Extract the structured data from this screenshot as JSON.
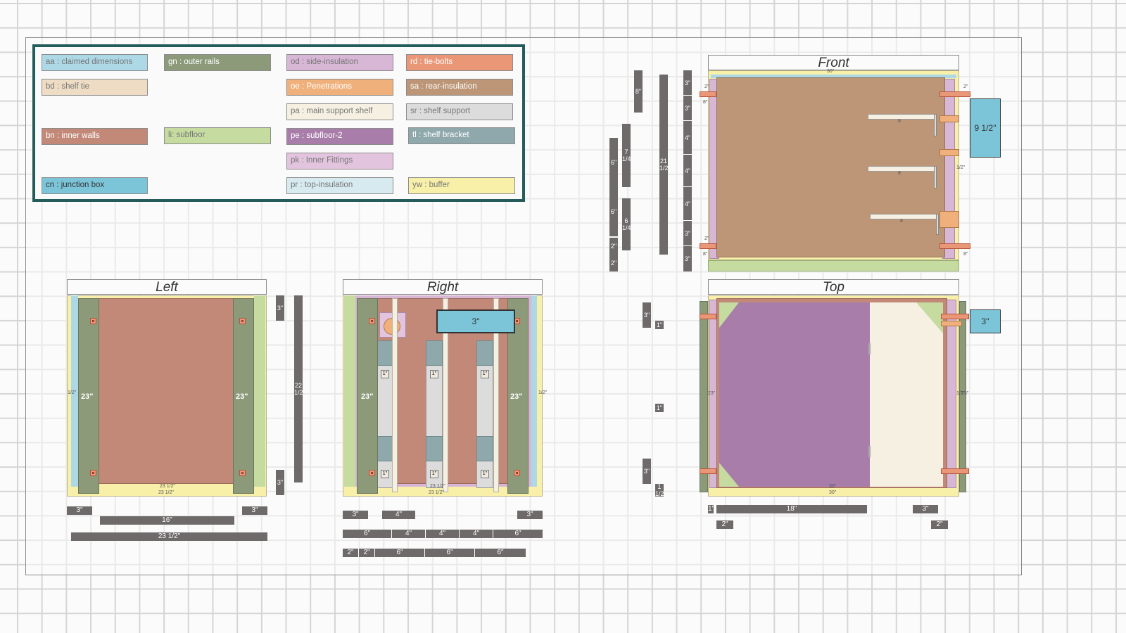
{
  "legend": [
    {
      "code": "aa",
      "label": "aa : claimed dimensions",
      "color": "#add8e6",
      "text": "#777777"
    },
    {
      "code": "gn",
      "label": "gn : outer rails",
      "color": "#8c9a7a",
      "text": "#ffffff"
    },
    {
      "code": "od",
      "label": "od : side-insulation",
      "color": "#d8b6d6",
      "text": "#777777"
    },
    {
      "code": "rd",
      "label": "rd : tie-bolts",
      "color": "#e99777",
      "text": "#ffffff"
    },
    {
      "code": "bd",
      "label": "bd : shelf tie",
      "color": "#eedcc4",
      "text": "#777777"
    },
    {
      "code": "oe",
      "label": "oe : Penetrations",
      "color": "#f0b07b",
      "text": "#ffffff"
    },
    {
      "code": "sa",
      "label": "sa : rear-insulation",
      "color": "#bc9676",
      "text": "#ffffff"
    },
    {
      "code": "pa",
      "label": "pa : main support shelf",
      "color": "#f5f0e2",
      "text": "#777777"
    },
    {
      "code": "sr",
      "label": "sr : shelf support",
      "color": "#dcdcdc",
      "text": "#777777"
    },
    {
      "code": "bn",
      "label": "bn : inner walls",
      "color": "#c28878",
      "text": "#ffffff"
    },
    {
      "code": "li",
      "label": "li: subfloor",
      "color": "#c5dba0",
      "text": "#777777"
    },
    {
      "code": "pe",
      "label": "pe : subfloor-2",
      "color": "#a87daa",
      "text": "#ffffff"
    },
    {
      "code": "tl",
      "label": "tl : shelf bracket",
      "color": "#8fa8ac",
      "text": "#ffffff"
    },
    {
      "code": "pk",
      "label": "pk : Inner Fittings",
      "color": "#e3c4de",
      "text": "#777777"
    },
    {
      "code": "cn",
      "label": "cn : junction box",
      "color": "#7cc5d9",
      "text": "#333333"
    },
    {
      "code": "pr",
      "label": "pr : top-insulation",
      "color": "#d6eaf0",
      "text": "#777777"
    },
    {
      "code": "yw",
      "label": "yw : buffer",
      "color": "#f8f0a8",
      "text": "#777777"
    }
  ],
  "views": {
    "front": "Front",
    "left": "Left",
    "right": "Right",
    "top": "Top"
  },
  "labels": {
    "left_rail": "23\"",
    "right_rail": "23\"",
    "right_box": "3\"",
    "front_box": "9 1/2\"",
    "top_box": "3\"",
    "shelf_mark": "8",
    "bolt_mark": "1\"",
    "front_top_tiny": "30\"",
    "bottom_tiny_a": "23 1/2\"",
    "bottom_tiny_b": "23 1/2\"",
    "top_tiny_a": "30\"",
    "top_tiny_b": "30\"",
    "side_tiny_23": "23\"",
    "side_tiny_frac": "1/2\"",
    "side_tiny_2": "2\"",
    "side_tiny_8": "8\""
  },
  "dims": {
    "left_3a": "3\"",
    "left_16": "16\"",
    "left_3b": "3\"",
    "left_23_5": "23 1/2\"",
    "left_v3a": "3\"",
    "left_v3b": "3\"",
    "left_v22": "22 1/2\"",
    "right_3a": "3\"",
    "right_4": "4\"",
    "right_3b": "3\"",
    "right_r2": [
      "6\"",
      "4\"",
      "4\"",
      "4\"",
      "6\""
    ],
    "right_r3": [
      "2\"",
      "2\"",
      "6\"",
      "6\"",
      "6\""
    ],
    "front_6a": "6\"",
    "front_6b": "6\"",
    "front_2a": "2\"",
    "front_2b": "2\"",
    "front_7": "7 1/4\"",
    "front_6q": "6 1/4\"",
    "front_8": "8\"",
    "front_21": "21 1/2\"",
    "front_col": [
      "3\"",
      "3\"",
      "4\"",
      "4\"",
      "4\"",
      "3\"",
      "3\""
    ],
    "top_v3a": "3\"",
    "top_v1a": "1\"",
    "top_v1b": "1\"",
    "top_v3b": "3\"",
    "top_v1c": "1 1/2\"",
    "top_18": "18\"",
    "top_3": "3\"",
    "top_s1": "1\"",
    "top_s2": "2\"",
    "top_s3": "2\""
  }
}
